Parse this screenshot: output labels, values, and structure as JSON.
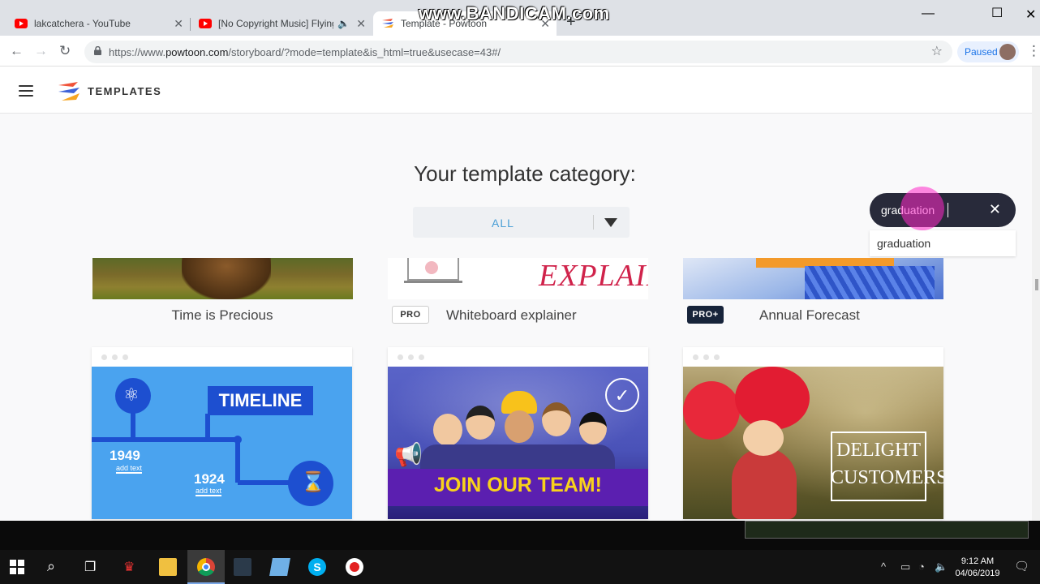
{
  "browser": {
    "tabs": [
      {
        "title": "lakcatchera - YouTube",
        "favicon": "youtube-icon"
      },
      {
        "title": "[No Copyright Music] Flying",
        "favicon": "youtube-icon",
        "audio": "speaker-icon"
      },
      {
        "title": "Template - Powtoon",
        "favicon": "powtoon-icon",
        "active": true
      }
    ],
    "url_scheme": "https://www.",
    "url_host": "powtoon.com",
    "url_path": "/storyboard/?mode=template&is_html=true&usecase=43#/",
    "profile_status": "Paused",
    "recording_watermark": "www.BANDICAM.com"
  },
  "app": {
    "section_title": "TEMPLATES",
    "heading": "Your template category:",
    "category_selected": "ALL",
    "search_value": "graduation",
    "search_suggestion": "graduation"
  },
  "templates_row1": [
    {
      "title": "Time is Precious",
      "badge": ""
    },
    {
      "title": "Whiteboard explainer",
      "badge": "PRO"
    },
    {
      "title": "Annual Forecast",
      "badge": "PRO+"
    }
  ],
  "template_thumbs": {
    "explainer_text": "EXPLAINER",
    "timeline": {
      "title": "TIMELINE",
      "year1": "1949",
      "year2": "1924",
      "sub": "add text"
    },
    "team": {
      "text": "JOIN OUR TEAM!"
    },
    "delight": {
      "line1": "DELIGHT",
      "line2": "CUSTOMERS"
    }
  },
  "taskbar": {
    "time": "9:12 AM",
    "date": "04/06/2019"
  },
  "colors": {
    "accent_blue": "#4a9fd6",
    "search_bg": "#282a3a",
    "pro_plus_bg": "#17243a"
  }
}
